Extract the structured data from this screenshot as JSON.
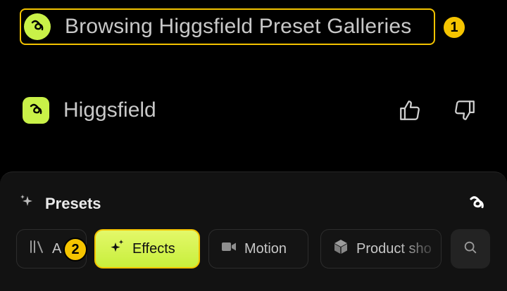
{
  "header_status": {
    "text": "Browsing Higgsfield Preset Galleries",
    "badge": "1",
    "icon": "higgsfield-logo-icon"
  },
  "message": {
    "sender": "Higgsfield",
    "icon": "higgsfield-logo-icon",
    "actions": [
      "thumbs-up-icon",
      "thumbs-down-icon"
    ]
  },
  "presets_panel": {
    "title": "Presets",
    "title_icon": "sparkle-icon",
    "corner_icon": "higgsfield-logo-icon",
    "chips": [
      {
        "label": "A",
        "icon": "library-icon",
        "selected": false
      },
      {
        "label": "Effects",
        "icon": "sparkles-icon",
        "selected": true,
        "badge": "2"
      },
      {
        "label": "Motion",
        "icon": "video-camera-icon",
        "selected": false
      },
      {
        "label": "Product sho",
        "icon": "box-icon",
        "selected": false
      }
    ],
    "search_icon": "search-icon"
  },
  "colors": {
    "accent": "#c9f148",
    "highlight": "#f3c300",
    "background": "#000000",
    "panel": "#121212"
  }
}
